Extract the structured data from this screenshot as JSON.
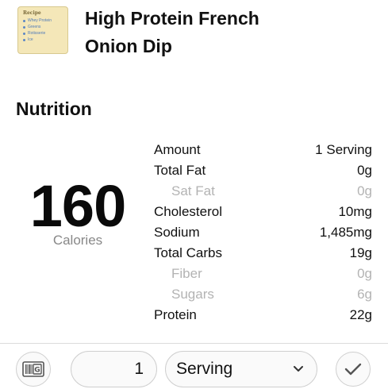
{
  "recipe": {
    "title_line1": "High Protein French",
    "title_line2": "Onion Dip",
    "icon_card": {
      "title": "Recipe",
      "lines": [
        "Whey Protein",
        "Greens",
        "Rotisserie",
        "Ice"
      ]
    }
  },
  "section_title": "Nutrition",
  "calories": {
    "value": "160",
    "label": "Calories"
  },
  "nutrition": {
    "header": {
      "label": "Amount",
      "value": "1 Serving"
    },
    "rows": [
      {
        "label": "Total Fat",
        "value": "0g",
        "sub": false
      },
      {
        "label": "Sat Fat",
        "value": "0g",
        "sub": true
      },
      {
        "label": "Cholesterol",
        "value": "10mg",
        "sub": false
      },
      {
        "label": "Sodium",
        "value": "1,485mg",
        "sub": false
      },
      {
        "label": "Total Carbs",
        "value": "19g",
        "sub": false
      },
      {
        "label": "Fiber",
        "value": "0g",
        "sub": true
      },
      {
        "label": "Sugars",
        "value": "6g",
        "sub": true
      },
      {
        "label": "Protein",
        "value": "22g",
        "sub": false
      }
    ]
  },
  "bottom_bar": {
    "barcode_icon": "barcode-scan-icon",
    "quantity": "1",
    "unit": "Serving",
    "dropdown_icon": "chevron-down-icon",
    "confirm_icon": "checkmark-icon"
  },
  "colors": {
    "secondary_text": "#888888",
    "sub_row_text": "#b3b3b3",
    "icon_card_bg": "#f4e7b8",
    "icon_card_dots": "#5b86c4"
  }
}
